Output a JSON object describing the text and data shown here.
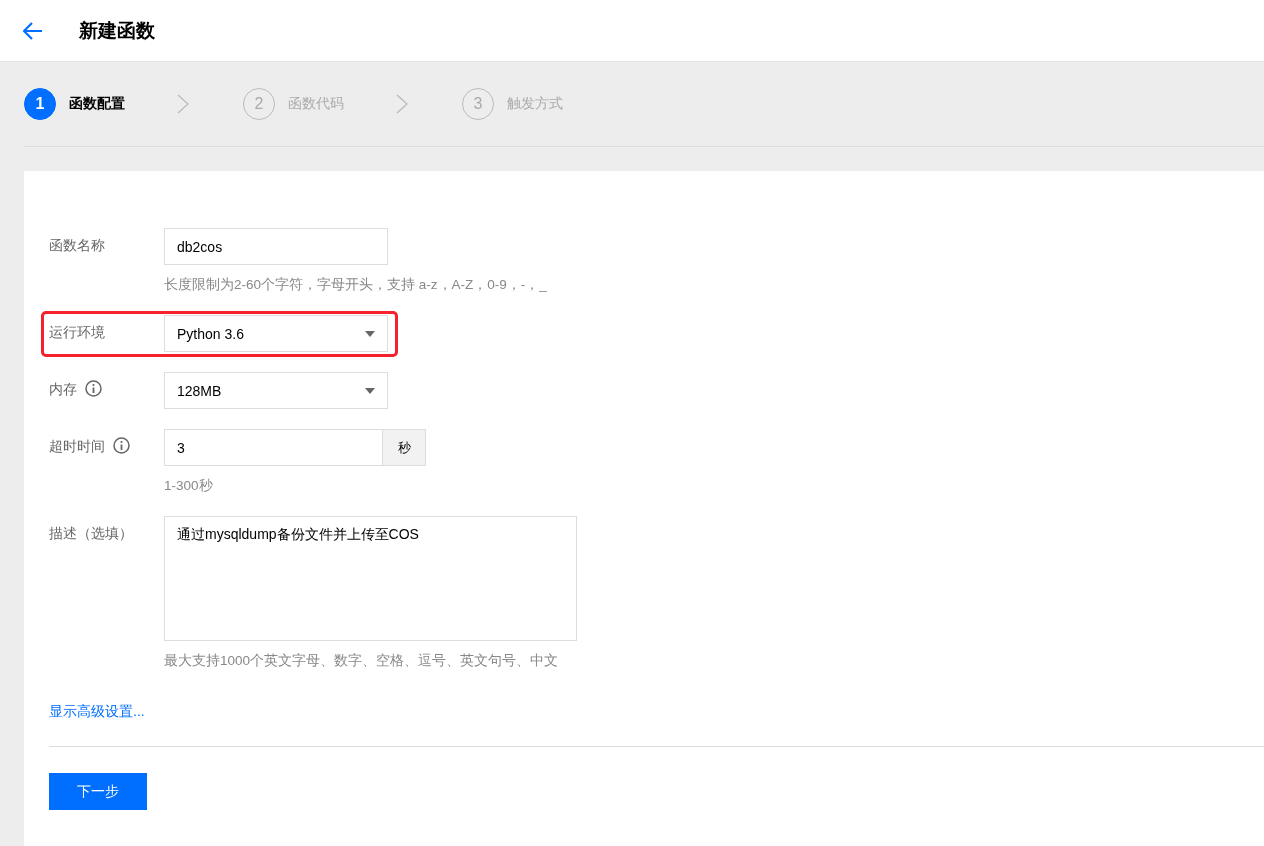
{
  "header": {
    "title": "新建函数"
  },
  "steps": [
    {
      "number": "1",
      "label": "函数配置",
      "selected": true
    },
    {
      "number": "2",
      "label": "函数代码",
      "selected": false
    },
    {
      "number": "3",
      "label": "触发方式",
      "selected": false
    }
  ],
  "form": {
    "fields": [
      {
        "kind": "text",
        "label": "函数名称",
        "value": "db2cos",
        "help": "长度限制为2-60个字符，字母开头，支持 a-z，A-Z，0-9，-，_",
        "info": false,
        "highlighted": false
      },
      {
        "kind": "select",
        "label": "运行环境",
        "value": "Python 3.6",
        "info": false,
        "highlighted": true
      },
      {
        "kind": "select",
        "label": "内存",
        "value": "128MB",
        "info": true,
        "highlighted": false
      },
      {
        "kind": "unit",
        "label": "超时时间",
        "value": "3",
        "unit": "秒",
        "help": "1-300秒",
        "info": true,
        "highlighted": false
      },
      {
        "kind": "textarea",
        "label": "描述（选填）",
        "value": "通过mysqldump备份文件并上传至COS",
        "help": "最大支持1000个英文字母、数字、空格、逗号、英文句号、中文",
        "info": false,
        "highlighted": false
      }
    ],
    "advanced_link": "显示高级设置...",
    "next_button": "下一步"
  }
}
